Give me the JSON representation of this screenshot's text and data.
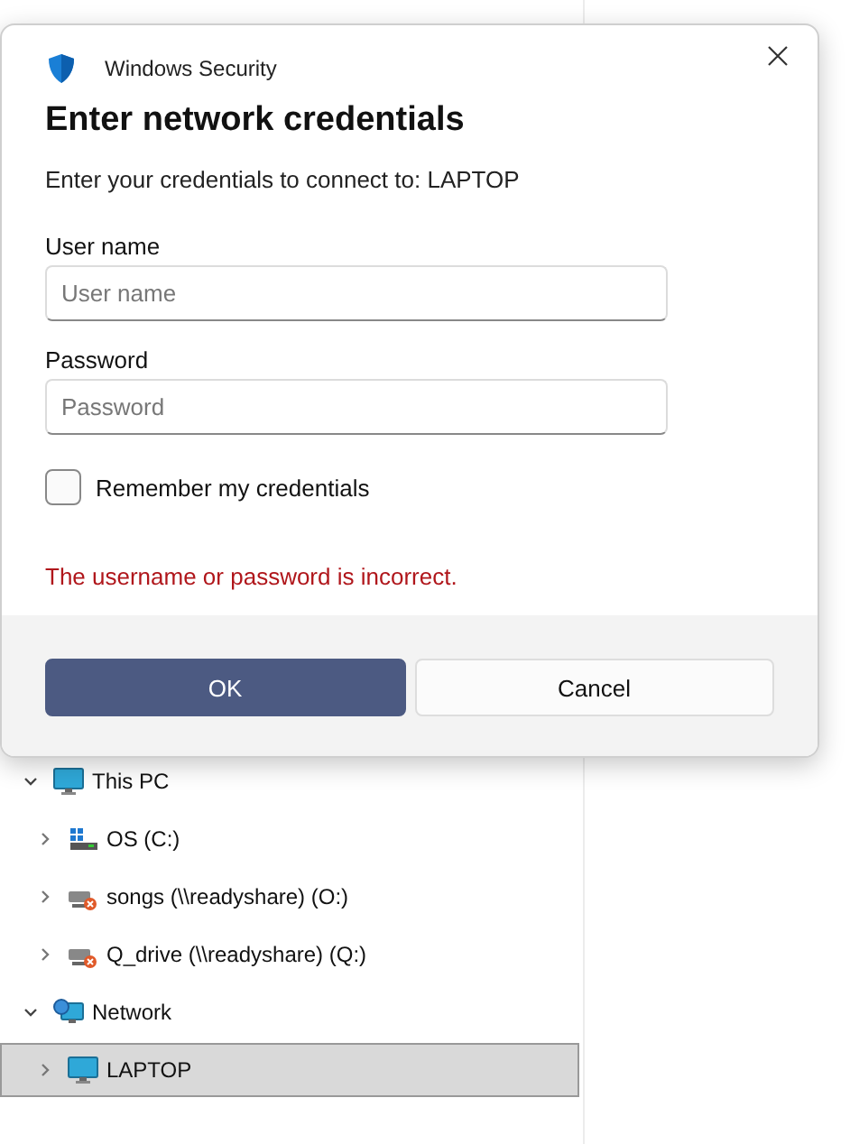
{
  "tree": [
    {
      "label": "This PC",
      "kind": "computer",
      "expanded": true,
      "selected": false,
      "children": [
        {
          "label": "OS (C:)",
          "kind": "drive",
          "expanded": false,
          "selected": false
        },
        {
          "label": "songs (\\\\readyshare) (O:)",
          "kind": "network-drive",
          "expanded": false,
          "selected": false
        },
        {
          "label": "Q_drive (\\\\readyshare) (Q:)",
          "kind": "network-drive",
          "expanded": false,
          "selected": false
        }
      ]
    },
    {
      "label": "Network",
      "kind": "network",
      "expanded": true,
      "selected": false,
      "children": [
        {
          "label": "LAPTOP",
          "kind": "computer",
          "expanded": false,
          "selected": true
        }
      ]
    }
  ],
  "dialog": {
    "app_title": "Windows Security",
    "heading": "Enter network credentials",
    "subtitle": "Enter your credentials to connect to: LAPTOP",
    "fields": [
      {
        "label": "User name",
        "placeholder": "User name"
      },
      {
        "label": "Password",
        "placeholder": "Password"
      }
    ],
    "remember": {
      "label": "Remember my credentials",
      "checked": false
    },
    "error": "The username or password is incorrect.",
    "buttons": [
      {
        "label": "OK",
        "primary": true
      },
      {
        "label": "Cancel",
        "primary": false
      }
    ]
  }
}
